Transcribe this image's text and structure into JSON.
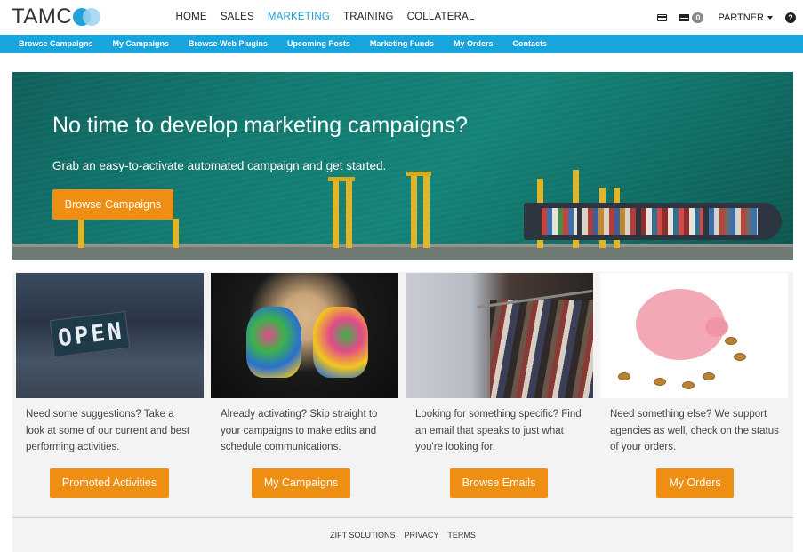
{
  "header": {
    "logo_text": "TAMC",
    "nav": [
      "HOME",
      "SALES",
      "MARKETING",
      "TRAINING",
      "COLLATERAL"
    ],
    "active_nav": "MARKETING",
    "mail_count": "0",
    "partner_label": "PARTNER",
    "help_label": "?"
  },
  "subnav": [
    "Browse Campaigns",
    "My Campaigns",
    "Browse Web Plugins",
    "Upcoming Posts",
    "Marketing Funds",
    "My Orders",
    "Contacts"
  ],
  "hero": {
    "title": "No time to develop marketing campaigns?",
    "subtitle": "Grab an easy-to-activate automated campaign and get started.",
    "button": "Browse Campaigns"
  },
  "cards": [
    {
      "image": "open-sign-image",
      "text": "Need some suggestions? Take a look at some of our current and best performing activities.",
      "button": "Promoted Activities"
    },
    {
      "image": "painted-hands-image",
      "text": "Already activating? Skip straight to your campaigns to make edits and schedule communications.",
      "button": "My Campaigns"
    },
    {
      "image": "clothing-rack-image",
      "text": "Looking for something specific? Find an email that speaks to just what you're looking for.",
      "button": "Browse Emails"
    },
    {
      "image": "piggy-bank-image",
      "text": "Need something else? We support agencies as well, check on the status of your orders.",
      "button": "My Orders"
    }
  ],
  "footer": [
    "ZIFT SOLUTIONS",
    "PRIVACY",
    "TERMS"
  ],
  "colors": {
    "accent": "#18a5de",
    "button": "#ee8e12"
  }
}
